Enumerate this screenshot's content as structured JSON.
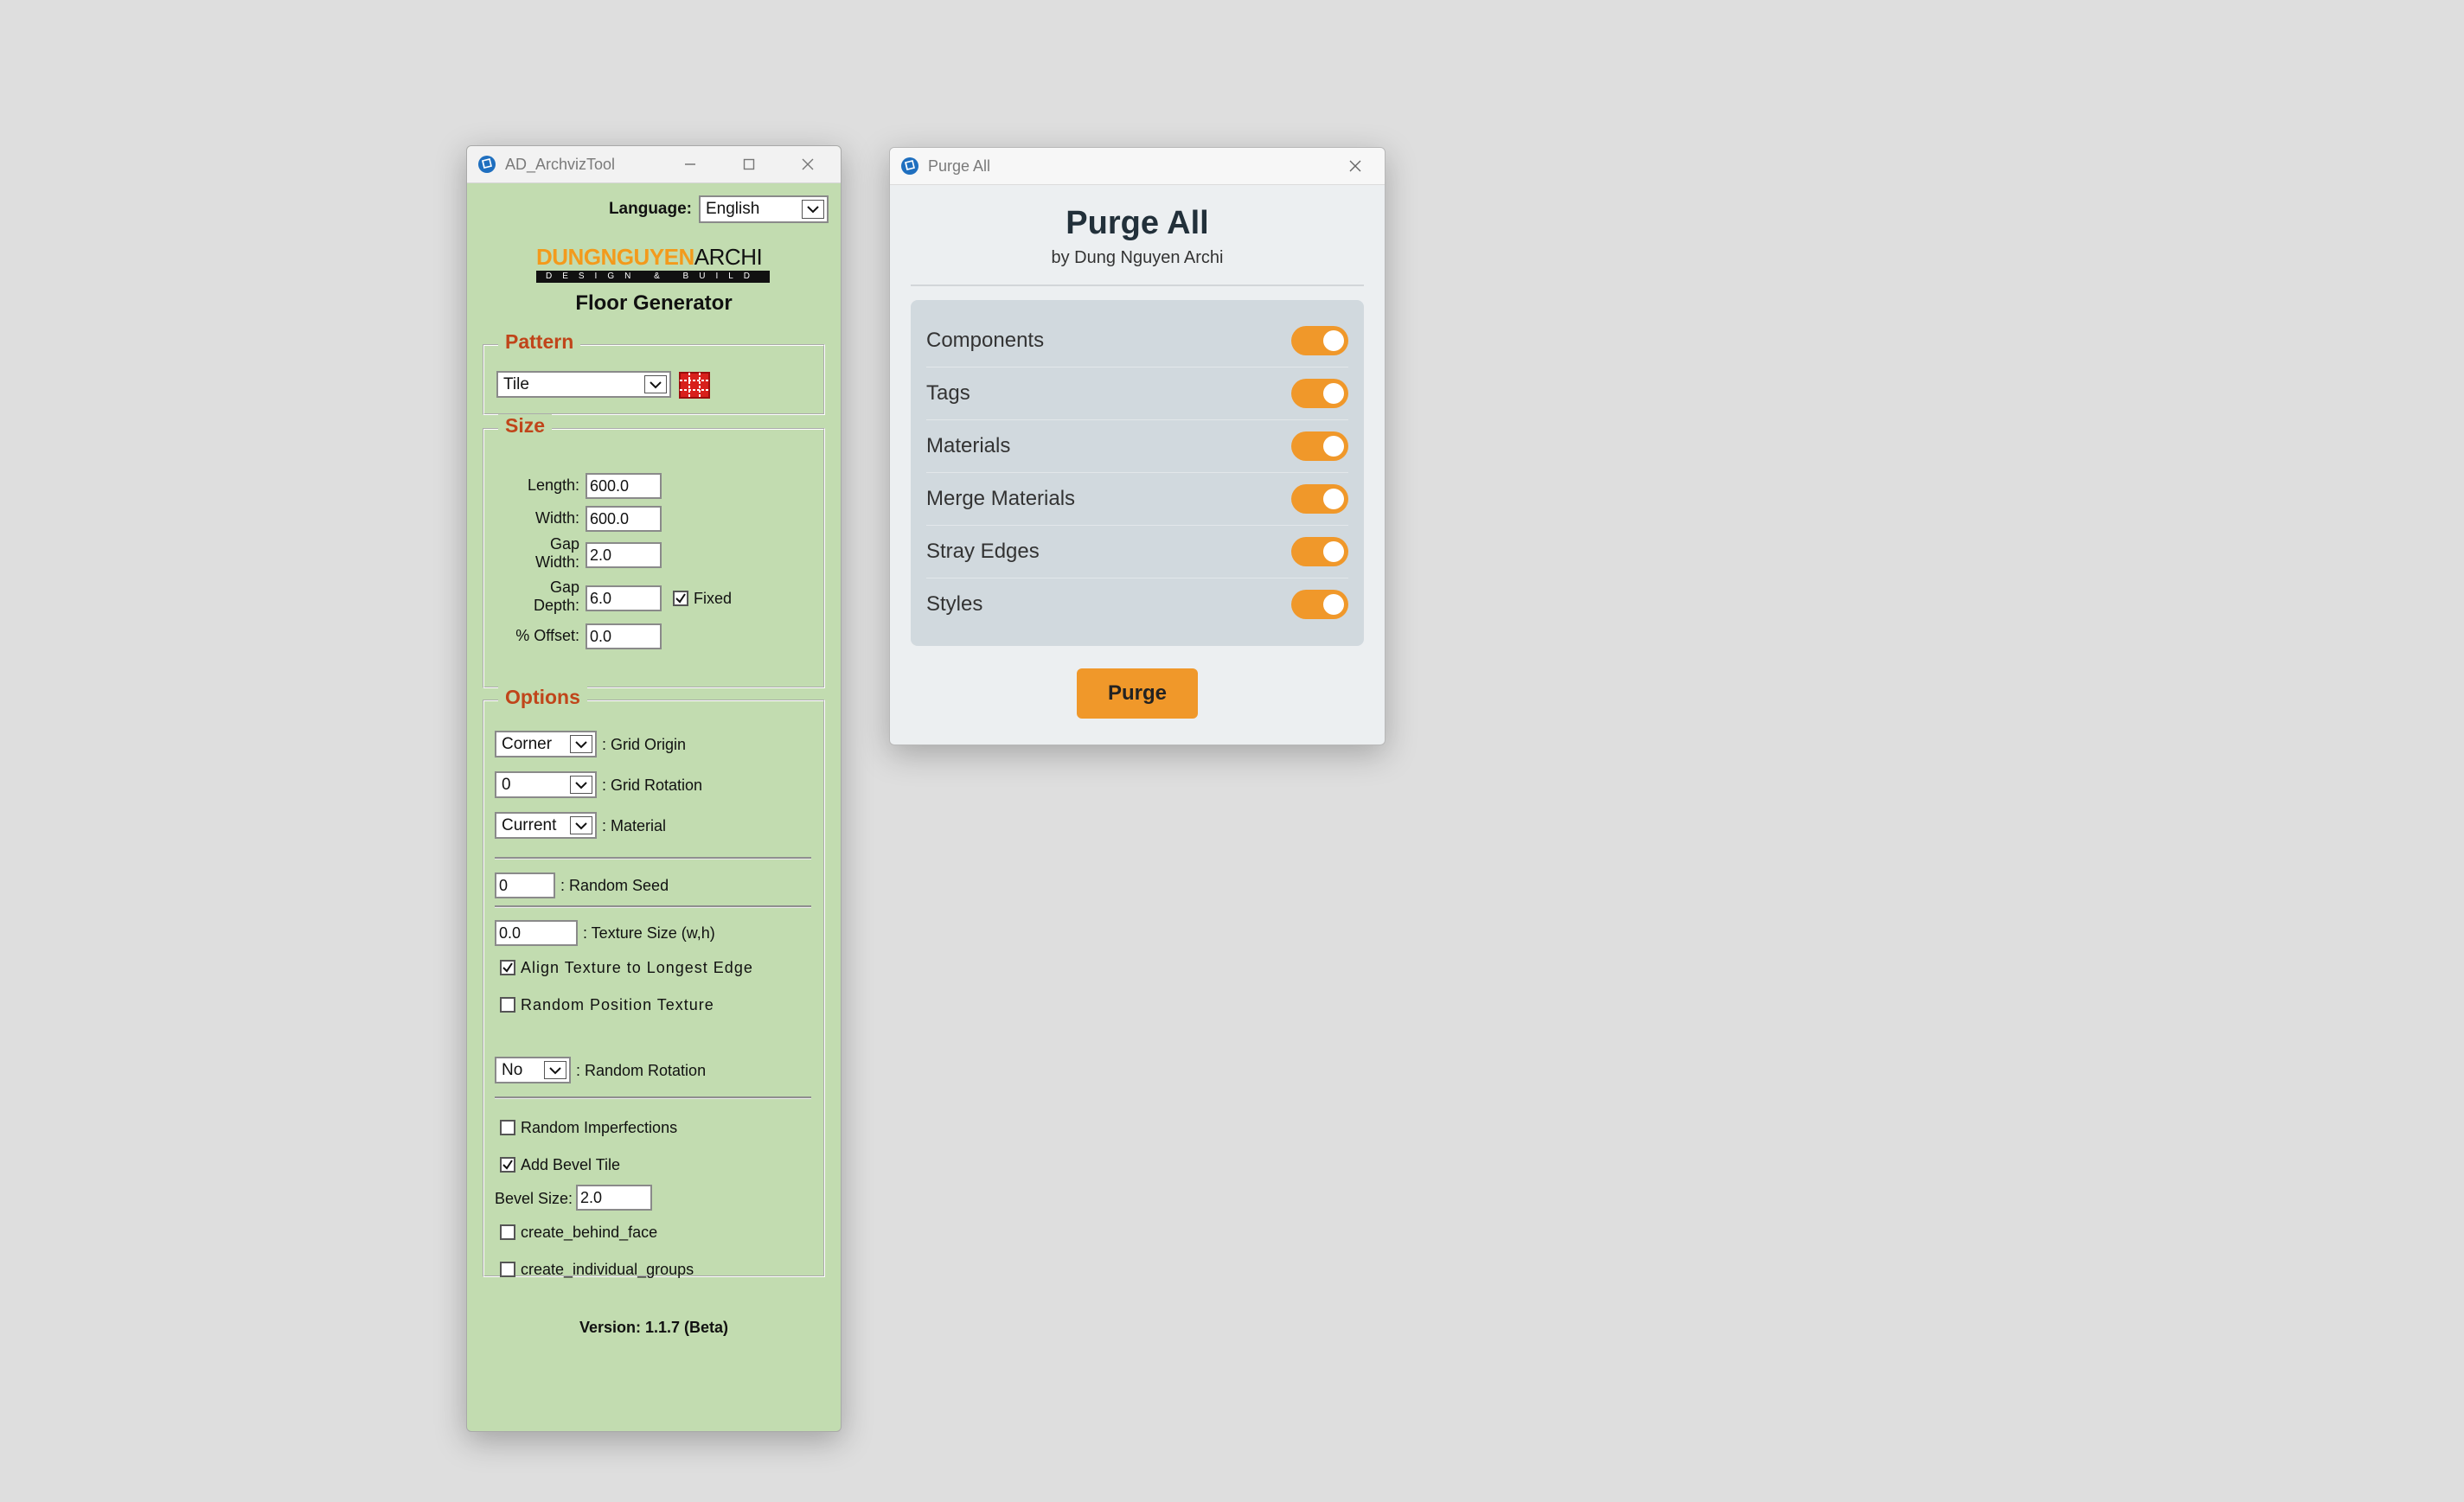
{
  "colors": {
    "accent": "#f0982a",
    "window1_bg": "#c2dcb0",
    "legend_red": "#c0451a"
  },
  "archviz": {
    "title": "AD_ArchvizTool",
    "icons": {
      "app": "sketchup-icon",
      "minimize": "minimize-icon",
      "maximize": "maximize-icon",
      "close": "close-icon"
    },
    "language_label": "Language:",
    "language_value": "English",
    "logo": {
      "part1": "DUNGNGUYEN",
      "part2": "ARCHI",
      "tagline": "DESIGN & BUILD"
    },
    "app_title": "Floor Generator",
    "pattern": {
      "legend": "Pattern",
      "value": "Tile",
      "icon": "tile-pattern-icon"
    },
    "size": {
      "legend": "Size",
      "length_label": "Length:",
      "length_value": "600.0",
      "width_label": "Width:",
      "width_value": "600.0",
      "gap_width_label_1": "Gap",
      "gap_width_label_2": "Width:",
      "gap_width_value": "2.0",
      "gap_depth_label_1": "Gap",
      "gap_depth_label_2": "Depth:",
      "gap_depth_value": "6.0",
      "fixed_label": "Fixed",
      "fixed_checked": true,
      "offset_label": "% Offset:",
      "offset_value": "0.0"
    },
    "options": {
      "legend": "Options",
      "grid_origin_value": "Corner",
      "grid_origin_label": ": Grid Origin",
      "grid_rotation_value": "0",
      "grid_rotation_label": ": Grid Rotation",
      "material_value": "Current",
      "material_label": ": Material",
      "random_seed_value": "0",
      "random_seed_label": ": Random Seed",
      "texture_size_value": "0.0",
      "texture_size_label": ": Texture Size (w,h)",
      "align_texture_label": "Align Texture to Longest Edge",
      "align_texture_checked": true,
      "random_position_label": "Random Position Texture",
      "random_position_checked": false,
      "random_rotation_value": "No",
      "random_rotation_label": ": Random Rotation",
      "random_imperfections_label": "Random Imperfections",
      "random_imperfections_checked": false,
      "add_bevel_label": "Add Bevel Tile",
      "add_bevel_checked": true,
      "bevel_size_label": "Bevel Size:",
      "bevel_size_value": "2.0",
      "behind_face_label": "create_behind_face",
      "behind_face_checked": false,
      "individual_groups_label": "create_individual_groups",
      "individual_groups_checked": false
    },
    "version": "Version: 1.1.7 (Beta)"
  },
  "purge": {
    "window_title": "Purge All",
    "icons": {
      "app": "sketchup-icon",
      "close": "close-icon"
    },
    "heading": "Purge All",
    "subtitle": "by Dung Nguyen Archi",
    "items": [
      {
        "label": "Components",
        "on": true
      },
      {
        "label": "Tags",
        "on": true
      },
      {
        "label": "Materials",
        "on": true
      },
      {
        "label": "Merge Materials",
        "on": true
      },
      {
        "label": "Stray Edges",
        "on": true
      },
      {
        "label": "Styles",
        "on": true
      }
    ],
    "button_label": "Purge"
  }
}
